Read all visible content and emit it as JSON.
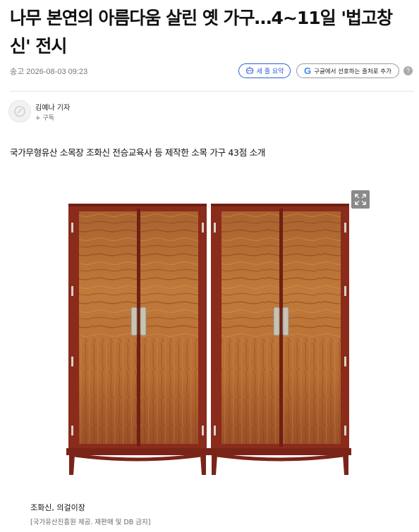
{
  "article": {
    "headline_line1": "나무 본연의 아름다움 살린 옛 가구…4~11일 '법고창",
    "headline_line2": "신' 전시",
    "pubdate": "송고 2026-08-03 09:23",
    "summary_button": "세 줄 요약",
    "preference_button": "구글에서 선호하는 출처로 추가",
    "author": "김예나 기자",
    "subscribe": "+ 구독",
    "subheading": "국가무형유산 소목장 조화신 전승교육사 등 제작한 소목 가구 43점 소개"
  },
  "photo": {
    "caption": "조화신, 의걸이장",
    "credit": "[국가유산진흥원 제공. 재판매 및 DB 금지]"
  },
  "icons": {
    "summary": "robot-icon",
    "google": "google-g-icon",
    "info": "info-icon",
    "expand": "expand-icon",
    "avatar": "avatar-icon"
  },
  "colors": {
    "accent_blue": "#2b5fd9",
    "wood_frame": "#8a2b1c",
    "wood_panel": "#b0662e"
  }
}
